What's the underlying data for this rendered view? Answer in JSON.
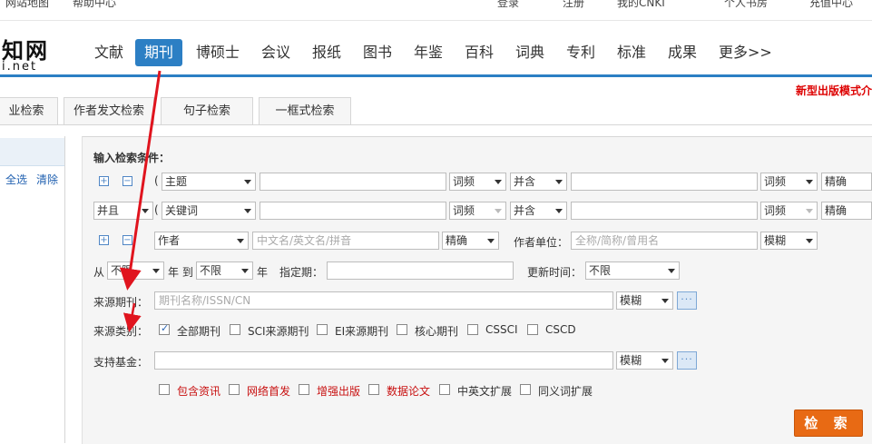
{
  "topbar": {
    "links": [
      "网站地图",
      "帮助中心",
      "登录",
      "注册",
      "我的CNKI",
      "个人书房",
      "充值中心"
    ]
  },
  "logo": {
    "cn": "知网",
    "en": "i.net"
  },
  "nav": {
    "tabs": [
      "文献",
      "期刊",
      "博硕士",
      "会议",
      "报纸",
      "图书",
      "年鉴",
      "百科",
      "词典",
      "专利",
      "标准",
      "成果",
      "更多>>"
    ]
  },
  "notice": "新型出版模式介",
  "search_tabs": [
    "业检索",
    "作者发文检索",
    "句子检索",
    "一框式检索"
  ],
  "sidebar": {
    "select_all": "全选",
    "clear": "清除"
  },
  "form": {
    "heading": "输入检索条件：",
    "row1": {
      "paren": "(",
      "field": "主题",
      "freq": "词频",
      "logic": "并含",
      "freq2": "词频",
      "match": "精确"
    },
    "row2": {
      "op": "并且",
      "paren": "(",
      "field": "关键词",
      "freq": "词频",
      "logic": "并含",
      "freq2": "词频",
      "match": "精确"
    },
    "row3": {
      "field": "作者",
      "placeholder": "中文名/英文名/拼音",
      "match": "精确",
      "unit_label": "作者单位：",
      "unit_placeholder": "全称/简称/曾用名",
      "unit_match": "模糊"
    },
    "row4": {
      "from": "从",
      "from_val": "不限",
      "year_to": "年 到",
      "to_val": "不限",
      "year": "年",
      "specified": "指定期：",
      "update_label": "更新时间：",
      "update_val": "不限"
    },
    "source_journal": {
      "label": "来源期刊：",
      "placeholder": "期刊名称/ISSN/CN",
      "match": "模糊",
      "more": "···"
    },
    "source_type": {
      "label": "来源类别：",
      "options": [
        {
          "label": "全部期刊",
          "checked": true
        },
        {
          "label": "SCI来源期刊",
          "checked": false
        },
        {
          "label": "EI来源期刊",
          "checked": false
        },
        {
          "label": "核心期刊",
          "checked": false
        },
        {
          "label": "CSSCI",
          "checked": false
        },
        {
          "label": "CSCD",
          "checked": false
        }
      ]
    },
    "fund": {
      "label": "支持基金：",
      "match": "模糊",
      "more": "···"
    },
    "extras": [
      {
        "label": "包含资讯",
        "red": true
      },
      {
        "label": "网络首发",
        "red": true
      },
      {
        "label": "增强出版",
        "red": true
      },
      {
        "label": "数据论文",
        "red": true
      },
      {
        "label": "中英文扩展",
        "red": false
      },
      {
        "label": "同义词扩展",
        "red": false
      }
    ],
    "plus": "+",
    "minus": "−"
  },
  "search_button": "检 索",
  "colors": {
    "accent": "#2c7fc4",
    "arrow": "#e0141e",
    "search_btn": "#e86a14",
    "notice": "#dd0000"
  }
}
